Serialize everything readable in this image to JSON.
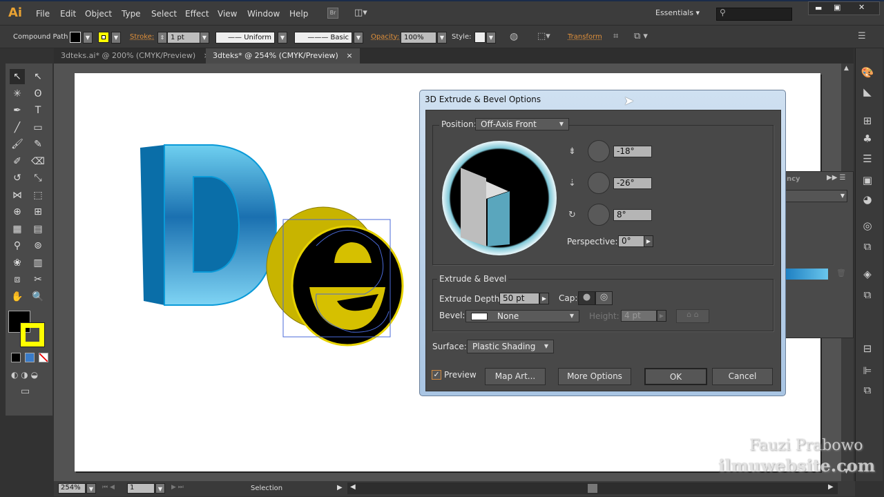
{
  "app": {
    "logo": "Ai",
    "menu": [
      "File",
      "Edit",
      "Object",
      "Type",
      "Select",
      "Effect",
      "View",
      "Window",
      "Help"
    ],
    "bridge": "Br",
    "workspace": "Essentials",
    "search_placeholder": ""
  },
  "control": {
    "selection_type": "Compound Path",
    "stroke_label": "Stroke:",
    "stroke_weight": "1 pt",
    "profile": "Uniform",
    "brush": "Basic",
    "opacity_label": "Opacity:",
    "opacity": "100%",
    "style_label": "Style:",
    "transform": "Transform",
    "fill_color": "#000000",
    "stroke_color": "#ffff00"
  },
  "tabs": [
    {
      "label": "3dteks.ai* @ 200% (CMYK/Preview)",
      "active": false
    },
    {
      "label": "3dteks* @ 254% (CMYK/Preview)",
      "active": true
    }
  ],
  "status": {
    "zoom": "254%",
    "artboard": "1",
    "tool": "Selection"
  },
  "panel": {
    "partial_title": "ncy"
  },
  "dialog": {
    "title": "3D Extrude & Bevel Options",
    "position_label": "Position:",
    "position": "Off-Axis Front",
    "rot_x": "-18°",
    "rot_y": "-26°",
    "rot_z": "8°",
    "perspective_label": "Perspective:",
    "perspective": "0°",
    "extrude_group": "Extrude & Bevel",
    "depth_label": "Extrude Depth:",
    "depth": "50 pt",
    "cap_label": "Cap:",
    "bevel_label": "Bevel:",
    "bevel": "None",
    "height_label": "Height:",
    "height": "4 pt",
    "surface_label": "Surface:",
    "surface": "Plastic Shading",
    "preview_label": "Preview",
    "preview_checked": true,
    "map_art": "Map Art...",
    "more_options": "More Options",
    "ok": "OK",
    "cancel": "Cancel"
  },
  "watermark": {
    "line1": "Fauzi Prabowo",
    "line2": "ilmuwebsite.com"
  }
}
